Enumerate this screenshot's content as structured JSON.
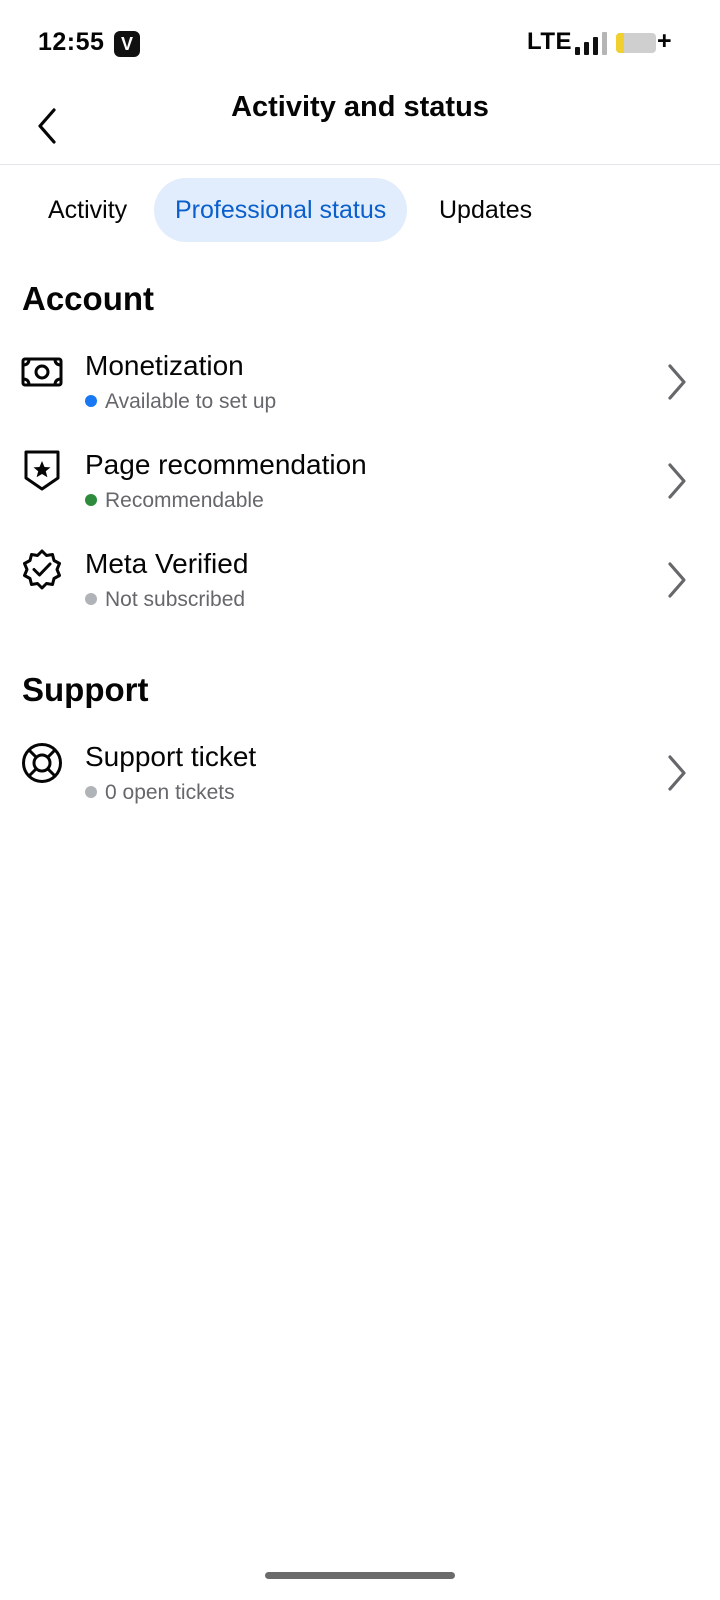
{
  "status_bar": {
    "time": "12:55",
    "app_badge": "V",
    "network": "LTE",
    "battery_plus": "+"
  },
  "header": {
    "title": "Activity and status"
  },
  "tabs": [
    {
      "label": "Activity",
      "active": false
    },
    {
      "label": "Professional status",
      "active": true
    },
    {
      "label": "Updates",
      "active": false
    }
  ],
  "account": {
    "title": "Account",
    "items": [
      {
        "title": "Monetization",
        "status": "Available to set up",
        "status_color": "#1877f2",
        "icon": "money-icon"
      },
      {
        "title": "Page recommendation",
        "status": "Recommendable",
        "status_color": "#2e8b3e",
        "icon": "shield-star-icon"
      },
      {
        "title": "Meta Verified",
        "status": "Not subscribed",
        "status_color": "#b0b3b8",
        "icon": "verified-badge-icon"
      }
    ]
  },
  "support": {
    "title": "Support",
    "items": [
      {
        "title": "Support ticket",
        "status": "0 open tickets",
        "status_color": "#b0b3b8",
        "icon": "lifebuoy-icon"
      }
    ]
  },
  "colors": {
    "accent": "#0a5fcc",
    "active_tab_bg": "#e1edfc",
    "secondary_text": "#65676b"
  }
}
